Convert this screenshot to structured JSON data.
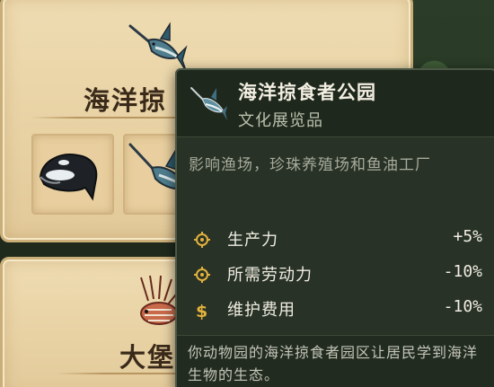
{
  "cards": [
    {
      "title": "海洋掠",
      "icon": "swordfish-icon",
      "slots": [
        {
          "icon": "orca-icon"
        },
        {
          "icon": "swordfish-icon"
        }
      ]
    },
    {
      "title": "大堡",
      "icon": "lionfish-icon"
    }
  ],
  "tooltip": {
    "icon": "swordfish-icon",
    "title": "海洋掠食者公园",
    "subtitle": "文化展览品",
    "description": "影响渔场，珍珠养殖场和鱼油工厂",
    "stats": [
      {
        "icon": "gear-icon",
        "label": "生产力",
        "value": "+5%"
      },
      {
        "icon": "gear-icon",
        "label": "所需劳动力",
        "value": "-10%"
      },
      {
        "icon": "dollar-icon",
        "label": "维护费用",
        "value": "-10%"
      }
    ],
    "footer": "你动物园的海洋掠食者园区让居民学到海洋生物的生态。"
  },
  "colors": {
    "card_bg": "#efdcb2",
    "tooltip_bg": "#283226",
    "accent_gold": "#e3b23c"
  }
}
